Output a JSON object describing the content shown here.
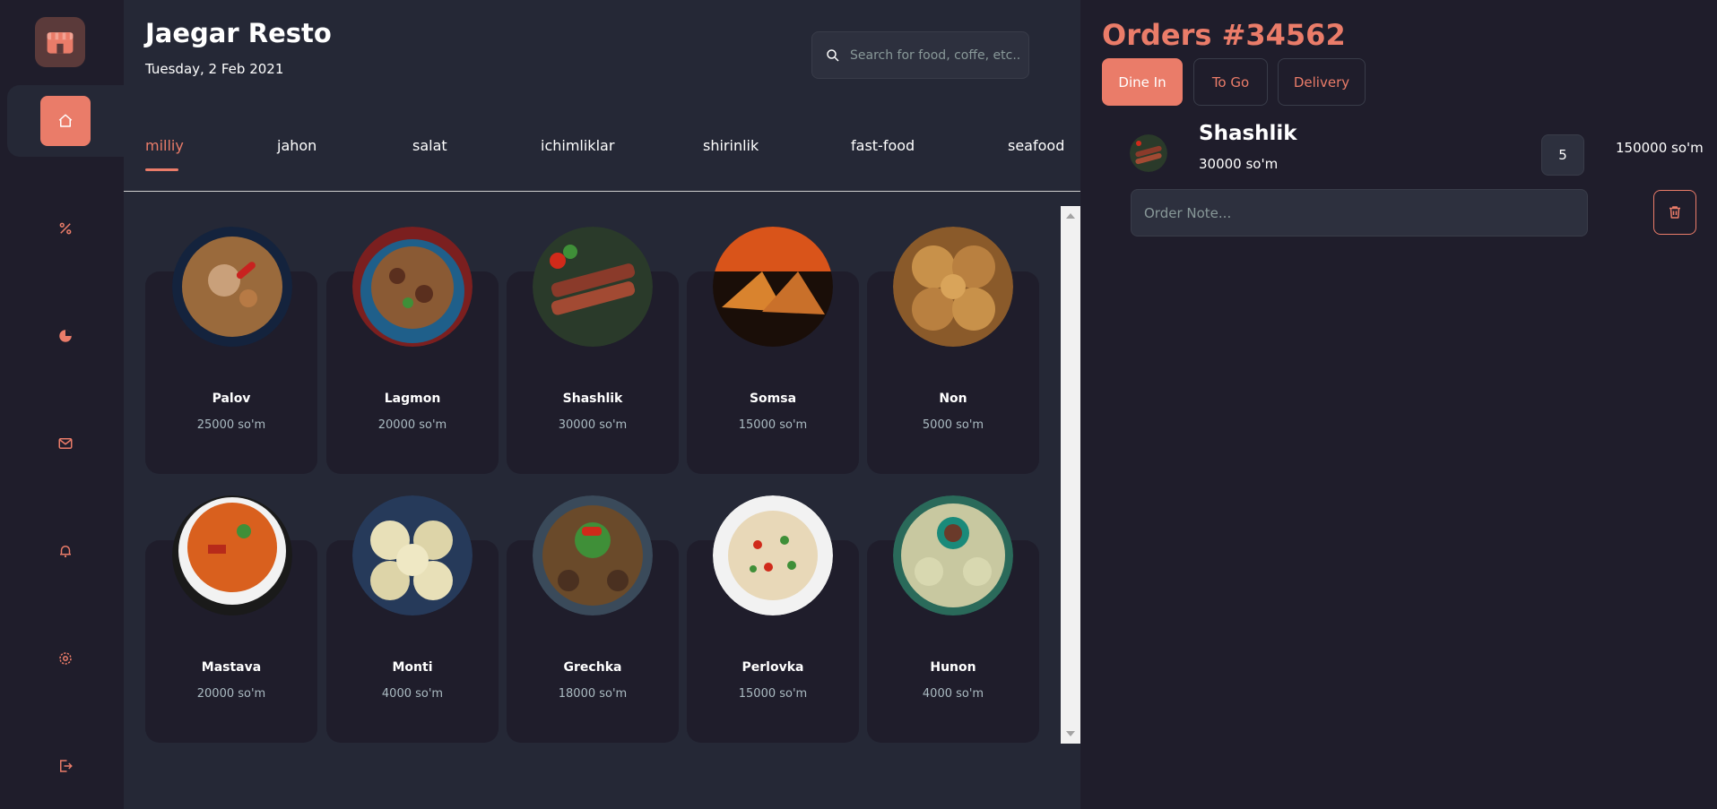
{
  "sidebar": {
    "items": [
      {
        "name": "home-icon",
        "active": true
      },
      {
        "name": "discount-icon",
        "active": false
      },
      {
        "name": "dashboard-icon",
        "active": false
      },
      {
        "name": "message-icon",
        "active": false
      },
      {
        "name": "notification-icon",
        "active": false
      },
      {
        "name": "settings-icon",
        "active": false
      },
      {
        "name": "logout-icon",
        "active": false
      }
    ]
  },
  "header": {
    "title": "Jaegar Resto",
    "date": "Tuesday, 2 Feb 2021"
  },
  "search": {
    "placeholder": "Search for food, coffe, etc.."
  },
  "tabs": [
    {
      "label": "milliy",
      "active": true
    },
    {
      "label": "jahon",
      "active": false
    },
    {
      "label": "salat",
      "active": false
    },
    {
      "label": "ichimliklar",
      "active": false
    },
    {
      "label": "shirinlik",
      "active": false
    },
    {
      "label": "fast-food",
      "active": false
    },
    {
      "label": "seafood",
      "active": false
    }
  ],
  "dishes": [
    {
      "name": "Palov",
      "price": "25000 so'm",
      "image": "plov"
    },
    {
      "name": "Lagmon",
      "price": "20000 so'm",
      "image": "lagman"
    },
    {
      "name": "Shashlik",
      "price": "30000 so'm",
      "image": "shashlik"
    },
    {
      "name": "Somsa",
      "price": "15000 so'm",
      "image": "samsa"
    },
    {
      "name": "Non",
      "price": "5000 so'm",
      "image": "bread"
    },
    {
      "name": "Mastava",
      "price": "20000 so'm",
      "image": "soup"
    },
    {
      "name": "Monti",
      "price": "4000 so'm",
      "image": "dumplings"
    },
    {
      "name": "Grechka",
      "price": "18000 so'm",
      "image": "buckwheat"
    },
    {
      "name": "Perlovka",
      "price": "15000 so'm",
      "image": "barley"
    },
    {
      "name": "Hunon",
      "price": "4000 so'm",
      "image": "khanum"
    }
  ],
  "orders": {
    "title": "Orders #34562",
    "tabs": [
      {
        "label": "Dine In",
        "active": true
      },
      {
        "label": "To Go",
        "active": false
      },
      {
        "label": "Delivery",
        "active": false
      }
    ],
    "item": {
      "name": "Shashlik",
      "unit_price": "30000 so'm",
      "quantity": "5",
      "total": "150000 so'm",
      "note_placeholder": "Order Note..."
    }
  },
  "colors": {
    "accent": "#ea7c69",
    "bg": "#252836",
    "panel": "#1f1d2b"
  }
}
